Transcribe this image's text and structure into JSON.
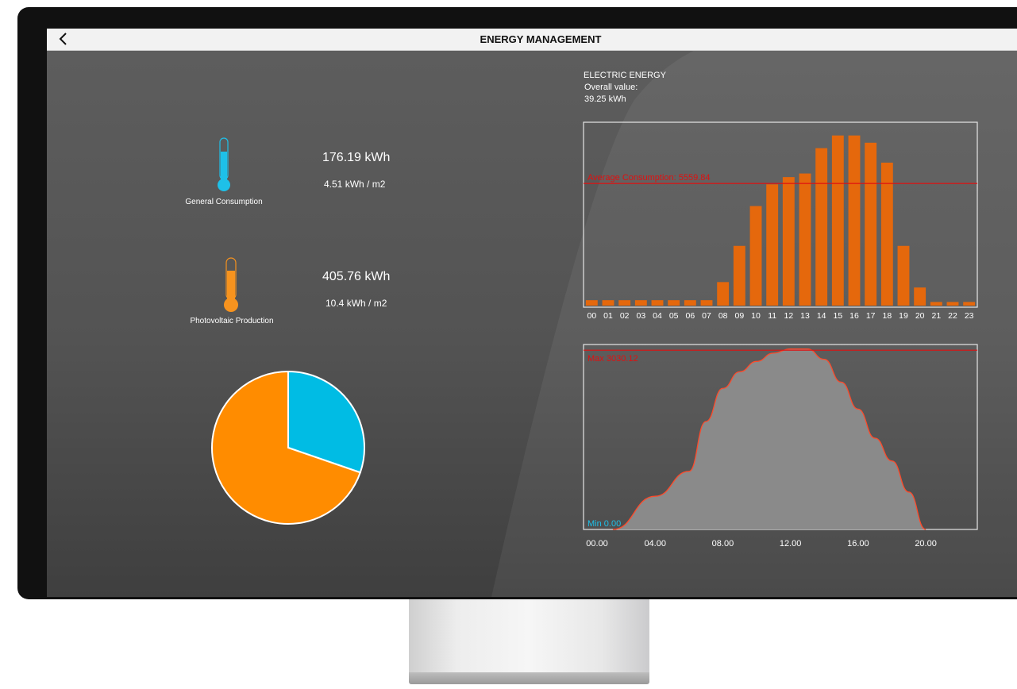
{
  "header": {
    "title": "ENERGY MANAGEMENT",
    "back_icon": "chevron-left-icon"
  },
  "consumption": {
    "total": "176.19 kWh",
    "per_area": "4.51 kWh / m2",
    "label": "General Consumption",
    "icon": "thermometer-icon",
    "color": "#1ec0e8"
  },
  "production": {
    "total": "405.76 kWh",
    "per_area": "10.4 kWh / m2",
    "label": "Photovoltaic Production",
    "icon": "thermometer-icon",
    "color": "#f7931e"
  },
  "energy": {
    "title": "ELECTRIC ENERGY",
    "overall_label": "Overall value:",
    "overall_value": "39.25 kWh"
  },
  "chart_data": [
    {
      "type": "pie",
      "labels": [
        "General Consumption",
        "Photovoltaic Production"
      ],
      "values": [
        176.19,
        405.76
      ],
      "colors": [
        "#00bce4",
        "#ff8c00"
      ]
    },
    {
      "type": "bar",
      "categories": [
        "00",
        "01",
        "02",
        "03",
        "04",
        "05",
        "06",
        "07",
        "08",
        "09",
        "10",
        "11",
        "12",
        "13",
        "14",
        "15",
        "16",
        "17",
        "18",
        "19",
        "20",
        "21",
        "22",
        "23"
      ],
      "values": [
        3,
        3,
        3,
        3,
        3,
        3,
        3,
        3,
        13,
        33,
        55,
        67,
        71,
        73,
        87,
        94,
        94,
        90,
        79,
        33,
        10,
        2,
        2,
        2
      ],
      "ylim": [
        0,
        100
      ],
      "annotation": "Average Consumption: 5559.84",
      "annotation_level": 67.5,
      "color": "#e5680c"
    },
    {
      "type": "area",
      "x_ticks": [
        "00.00",
        "04.00",
        "08.00",
        "12.00",
        "16.00",
        "20.00"
      ],
      "x": [
        1.5,
        4,
        6,
        7,
        8,
        9,
        10,
        11,
        12,
        13,
        14,
        15,
        16,
        17,
        18,
        19,
        20
      ],
      "y": [
        0,
        800,
        1400,
        2600,
        3400,
        3800,
        4050,
        4250,
        4350,
        4350,
        4100,
        3550,
        2900,
        2200,
        1650,
        900,
        0
      ],
      "xlim": [
        0,
        23
      ],
      "ylim": [
        0,
        4400
      ],
      "max_label": "Max 3030.12",
      "min_label": "Min 0.00",
      "max_level": 4320,
      "fill": "#8a8a8a",
      "line": "#ff4a2a"
    }
  ]
}
